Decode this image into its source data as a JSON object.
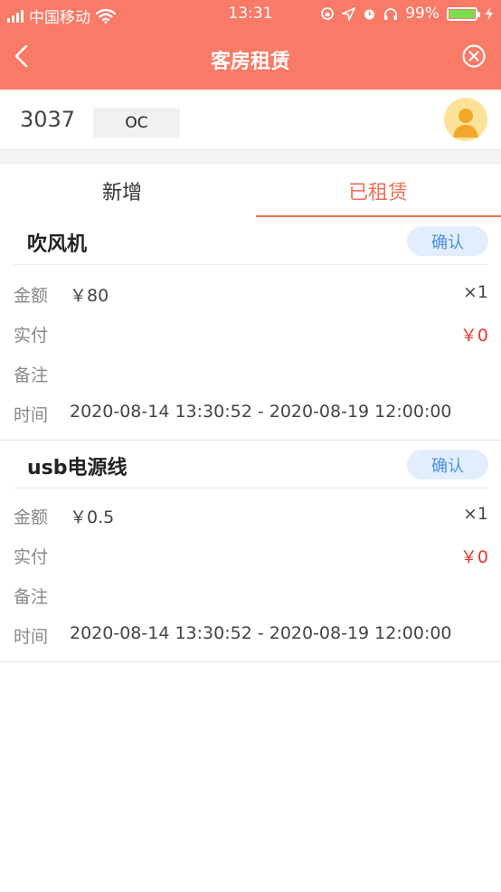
{
  "status_bar": {
    "carrier": "中国移动",
    "time": "13:31",
    "battery_percent": "99%",
    "battery_level": 0.99
  },
  "nav": {
    "title": "客房租赁",
    "back_icon": "chevron-left-icon",
    "close_icon": "close-circle-icon"
  },
  "profile": {
    "room_number": "3037",
    "guest_tag": "OC"
  },
  "tabs": [
    {
      "label": "新增",
      "active": false
    },
    {
      "label": "已租赁",
      "active": true
    }
  ],
  "items": [
    {
      "name": "吹风机",
      "confirm_label": "确认",
      "amount_label": "金额",
      "amount": "￥80",
      "quantity": "×1",
      "paid_label": "实付",
      "paid": "￥0",
      "note_label": "备注",
      "time_label": "时间",
      "time_range": "2020-08-14 13:30:52 - 2020-08-19 12:00:00"
    },
    {
      "name": "usb电源线",
      "confirm_label": "确认",
      "amount_label": "金额",
      "amount": "￥0.5",
      "quantity": "×1",
      "paid_label": "实付",
      "paid": "￥0",
      "note_label": "备注",
      "time_label": "时间",
      "time_range": "2020-08-14 13:30:52 - 2020-08-19 12:00:00"
    }
  ],
  "colors": {
    "header": "#f87a67",
    "active_tab": "#f26d56",
    "paid_red": "#e8392a",
    "confirm_bg": "#e2eefb",
    "confirm_text": "#4a90e2"
  }
}
